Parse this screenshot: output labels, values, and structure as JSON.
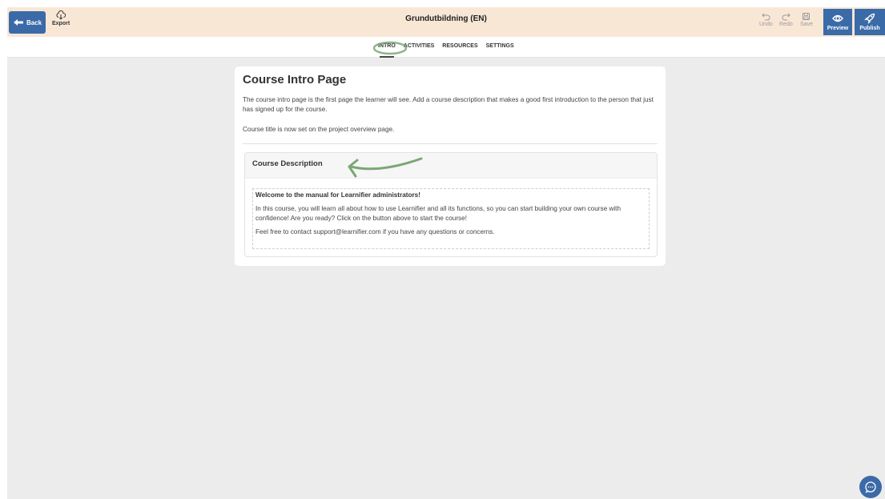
{
  "topbar": {
    "back_label": "Back",
    "export_label": "Export",
    "title": "Grundutbildning (EN)",
    "undo_label": "Undo",
    "redo_label": "Redo",
    "save_label": "Save",
    "preview_label": "Preview",
    "publish_label": "Publish"
  },
  "tabs": [
    {
      "label": "INTRO",
      "active": true
    },
    {
      "label": "ACTIVITIES",
      "active": false
    },
    {
      "label": "RESOURCES",
      "active": false
    },
    {
      "label": "SETTINGS",
      "active": false
    }
  ],
  "card": {
    "title": "Course Intro Page",
    "intro_text": "The course intro page is the first page the learner will see. Add a course description that makes a good first introduction to the person that just has signed up for the course.",
    "title_note": "Course title is now set on the project overview page.",
    "description": {
      "heading": "Course Description",
      "welcome": "Welcome to the manual for Learnifier administrators!",
      "body": "In this course, you will learn all about how to use Learnifier and all its functions, so you can start building your own course with confidence! Are you ready? Click on the button above to start the course!",
      "contact": "Feel free to contact support@learnifier.com if you have any questions or concerns."
    }
  },
  "colors": {
    "topbar_bg": "#f9e7d6",
    "accent_blue": "#3b6aa8",
    "annotation_green": "#7aa874",
    "page_bg": "#ececec"
  },
  "icons": [
    "arrow-left-icon",
    "cloud-download-icon",
    "undo-icon",
    "redo-icon",
    "save-icon",
    "eye-icon",
    "rocket-icon",
    "chat-icon"
  ]
}
